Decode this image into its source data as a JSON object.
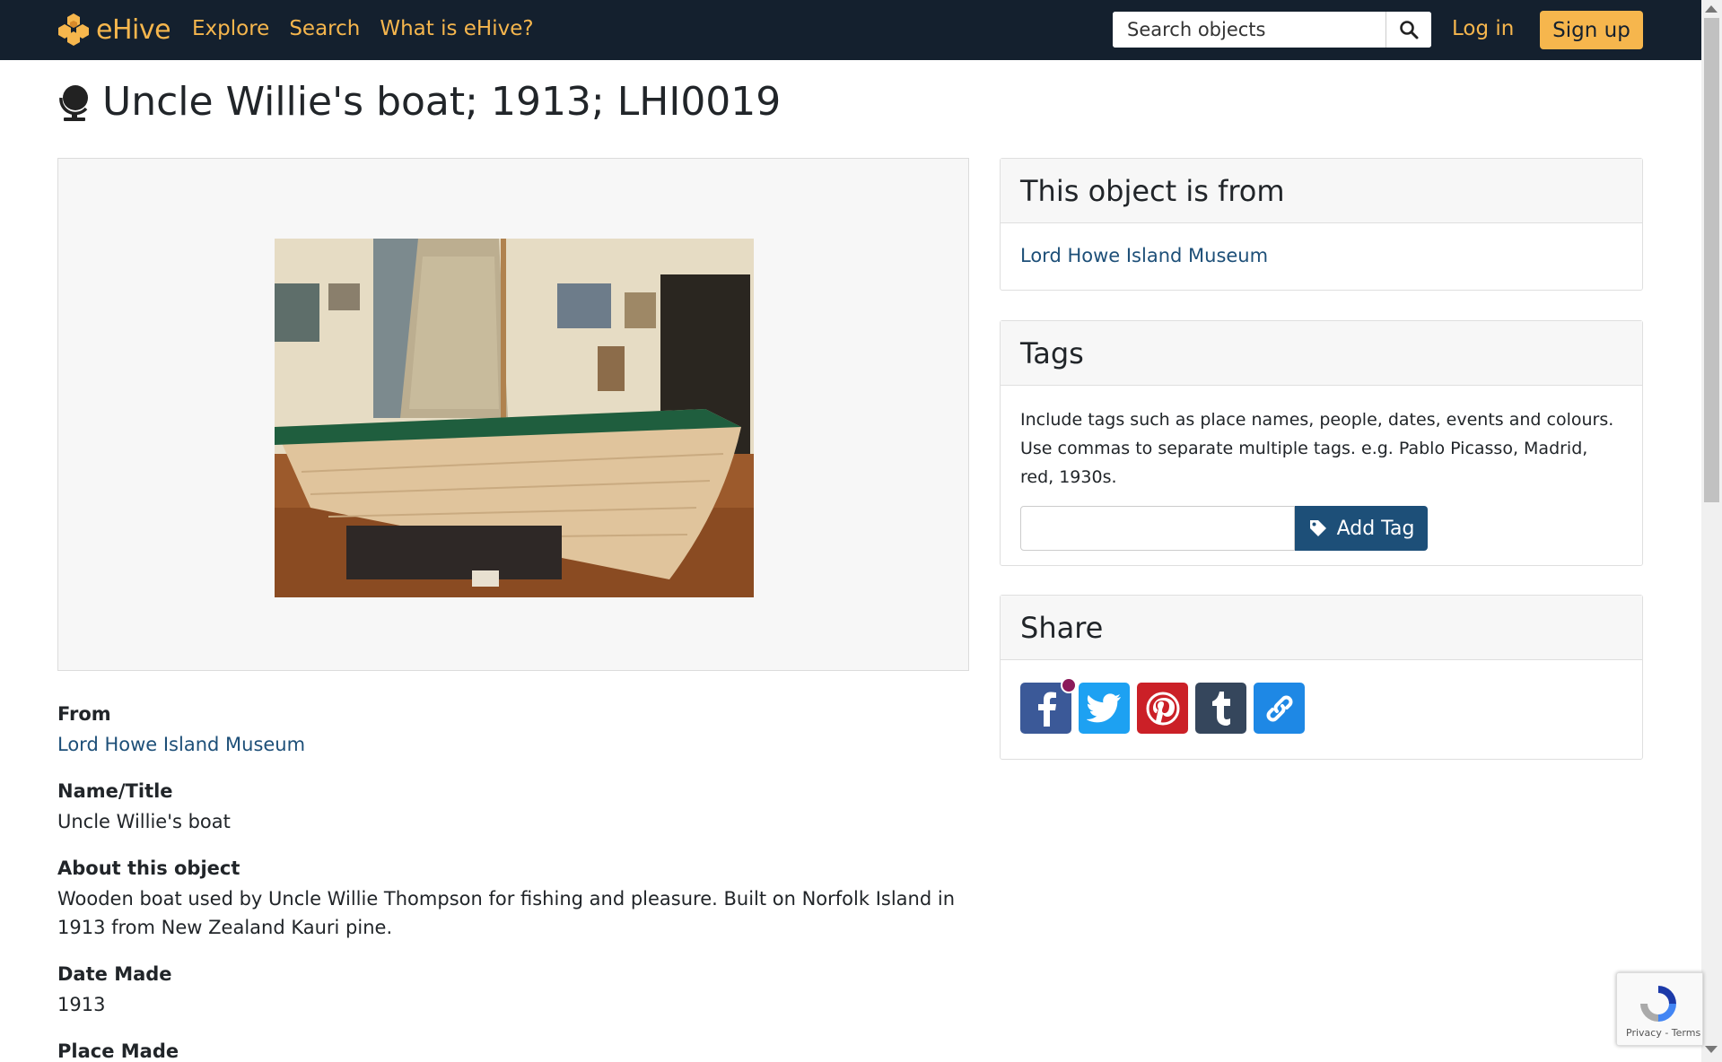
{
  "nav": {
    "brand": "eHive",
    "links": [
      "Explore",
      "Search",
      "What is eHive?"
    ],
    "search_placeholder": "Search objects",
    "login": "Log in",
    "signup": "Sign up"
  },
  "object": {
    "title": "Uncle Willie's boat; 1913; LHI0019",
    "fields": [
      {
        "label": "From",
        "value": "Lord Howe Island Museum"
      },
      {
        "label": "Name/Title",
        "value": "Uncle Willie's boat"
      },
      {
        "label": "About this object",
        "value": "Wooden boat used by Uncle Willie Thompson for fishing and pleasure. Built on Norfolk Island in 1913 from New Zealand Kauri pine."
      },
      {
        "label": "Date Made",
        "value": "1913"
      },
      {
        "label": "Place Made",
        "value": ""
      }
    ]
  },
  "sidebar": {
    "from_card": {
      "title": "This object is from",
      "link": "Lord Howe Island Museum"
    },
    "tags_card": {
      "title": "Tags",
      "help": "Include tags such as place names, people, dates, events and colours. Use commas to separate multiple tags. e.g. Pablo Picasso, Madrid, red, 1930s.",
      "button": "Add Tag"
    },
    "share_card": {
      "title": "Share",
      "buttons": [
        {
          "name": "facebook",
          "color": "#3b5998"
        },
        {
          "name": "twitter",
          "color": "#1da1f2"
        },
        {
          "name": "pinterest",
          "color": "#cb2027"
        },
        {
          "name": "tumblr",
          "color": "#35465c"
        },
        {
          "name": "link",
          "color": "#1e88e5"
        }
      ]
    }
  },
  "recaptcha": {
    "footer": "Privacy - Terms"
  },
  "colors": {
    "nav_bg": "#14202e",
    "accent": "#f6b64d",
    "link": "#1d4f78"
  }
}
